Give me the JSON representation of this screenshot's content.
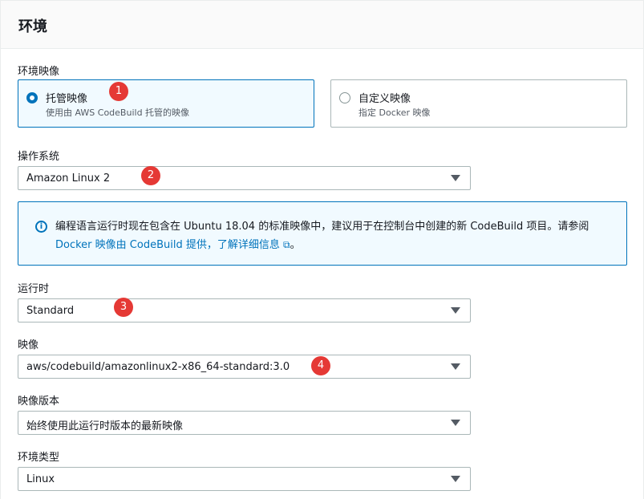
{
  "panel": {
    "title": "环境"
  },
  "image_section": {
    "label": "环境映像",
    "options": [
      {
        "title": "托管映像",
        "description": "使用由 AWS CodeBuild 托管的映像",
        "selected": true
      },
      {
        "title": "自定义映像",
        "description": "指定 Docker 映像",
        "selected": false
      }
    ]
  },
  "os": {
    "label": "操作系统",
    "value": "Amazon Linux 2"
  },
  "info": {
    "icon": "info-icon",
    "text_prefix": "编程语言运行时现在包含在 Ubuntu 18.04 的标准映像中，建议用于在控制台中创建的新 CodeBuild 项目。请参阅 ",
    "link_text": "Docker 映像由 CodeBuild 提供，了解详细信息",
    "link_icon": "external-link-icon",
    "suffix": "。"
  },
  "runtime": {
    "label": "运行时",
    "value": "Standard"
  },
  "image": {
    "label": "映像",
    "value": "aws/codebuild/amazonlinux2-x86_64-standard:3.0"
  },
  "image_version": {
    "label": "映像版本",
    "value": "始终使用此运行时版本的最新映像"
  },
  "environment_type": {
    "label": "环境类型",
    "value": "Linux"
  },
  "annotations": [
    "1",
    "2",
    "3",
    "4"
  ],
  "colors": {
    "accent": "#0073bb",
    "badge": "#e53935"
  }
}
